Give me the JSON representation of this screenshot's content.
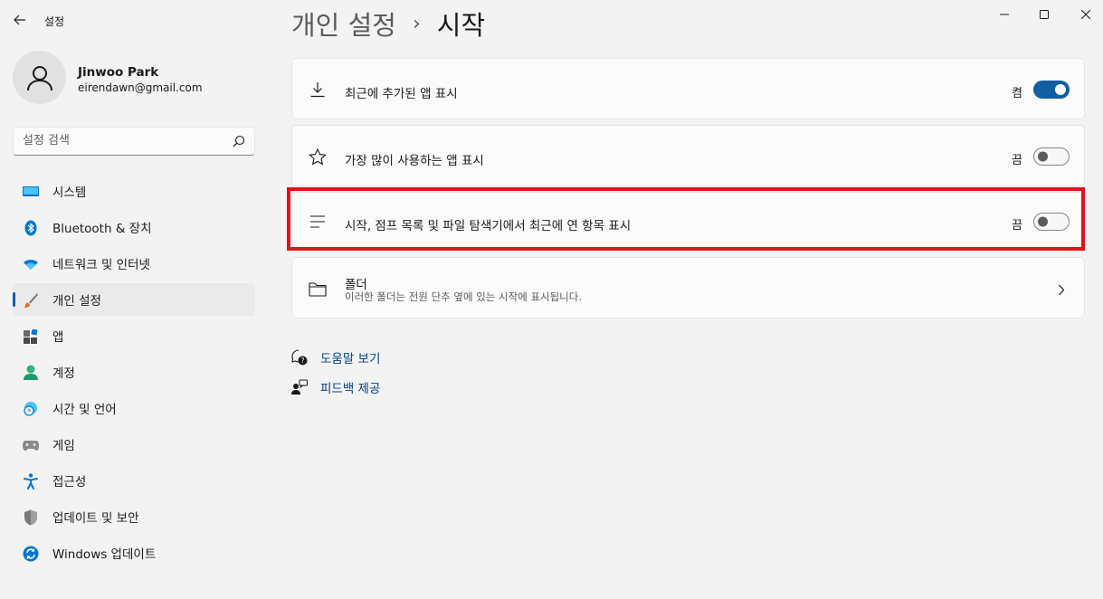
{
  "window": {
    "title": "설정"
  },
  "profile": {
    "name": "Jinwoo Park",
    "email": "eirendawn@gmail.com"
  },
  "search": {
    "placeholder": "설정 검색"
  },
  "sidebar": {
    "items": [
      {
        "label": "시스템",
        "icon": "system-icon"
      },
      {
        "label": "Bluetooth & 장치",
        "icon": "bluetooth-icon"
      },
      {
        "label": "네트워크 및 인터넷",
        "icon": "wifi-icon"
      },
      {
        "label": "개인 설정",
        "icon": "brush-icon",
        "active": true
      },
      {
        "label": "앱",
        "icon": "apps-icon"
      },
      {
        "label": "계정",
        "icon": "person-icon"
      },
      {
        "label": "시간 및 언어",
        "icon": "globe-clock-icon"
      },
      {
        "label": "게임",
        "icon": "gamepad-icon"
      },
      {
        "label": "접근성",
        "icon": "accessibility-icon"
      },
      {
        "label": "업데이트 및 보안",
        "icon": "shield-icon"
      },
      {
        "label": "Windows 업데이트",
        "icon": "update-icon"
      }
    ]
  },
  "breadcrumb": {
    "parent": "개인 설정",
    "separator": "›",
    "current": "시작"
  },
  "settings": {
    "recent_apps": {
      "label": "최근에 추가된 앱 표시",
      "state": "켬",
      "on": true
    },
    "most_used": {
      "label": "가장 많이 사용하는 앱 표시",
      "state": "끔",
      "on": false
    },
    "recent_items": {
      "label": "시작, 점프 목록 및 파일 탐색기에서 최근에 연 항목 표시",
      "state": "끔",
      "on": false
    },
    "folders": {
      "label": "폴더",
      "description": "이러한 폴더는 전원 단추 옆에 있는 시작에 표시됩니다."
    }
  },
  "links": {
    "help": "도움말 보기",
    "feedback": "피드백 제공"
  },
  "colors": {
    "accent": "#115ea3",
    "highlight": "#e2111b",
    "link": "#003e92"
  }
}
